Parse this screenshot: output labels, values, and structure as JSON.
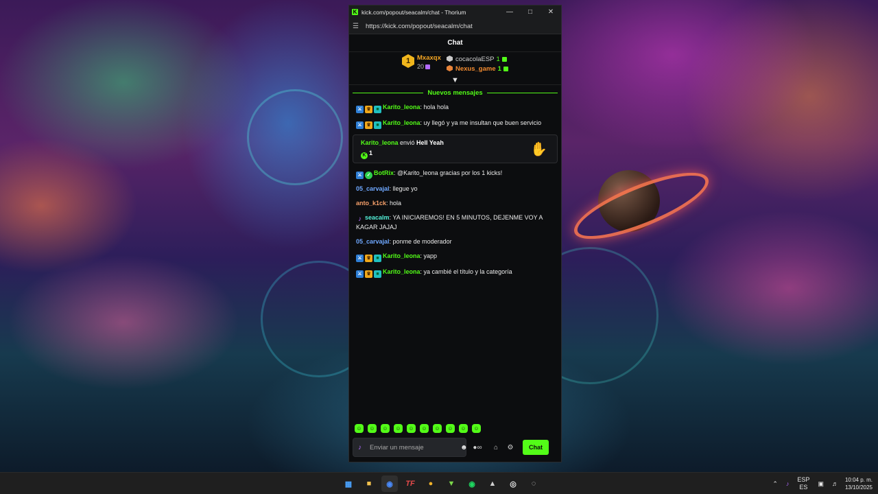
{
  "window": {
    "title": "kick.com/popout/seacalm/chat - Thorium",
    "url": "https://kick.com/popout/seacalm/chat",
    "logo_letter": "K"
  },
  "chat": {
    "header": "Chat",
    "leaderboard": {
      "top": {
        "rank": "1",
        "name": "Mxaxqx",
        "count": "20"
      },
      "others": [
        {
          "name": "cocacolaESP",
          "count": "1"
        },
        {
          "name": "Nexus_game",
          "count": "1"
        }
      ]
    },
    "new_messages_label": "Nuevos mensajes",
    "messages_before_gift": [
      {
        "name": "Karito_leona",
        "text": ": hola hola"
      },
      {
        "name": "Karito_leona",
        "text": ": uy llegó y ya me insultan que buen servicio"
      }
    ],
    "gift": {
      "sender": "Karito_leona",
      "verb": " envió ",
      "item": "Hell Yeah",
      "amount": "1"
    },
    "botrix": {
      "name": "BotRix",
      "text": ": @Karito_leona gracias por los 1 kicks!"
    },
    "plain_messages": [
      {
        "name": "05_carvajal",
        "text": ": llegue yo"
      },
      {
        "name": "anto_k1ck",
        "text": ": hola"
      }
    ],
    "streamer_msg": {
      "name": "seacalm",
      "text": ": YA INICIAREMOS! EN 5 MINUTOS, DEJENME VOY A KAGAR JAJAJ"
    },
    "carvajal2": {
      "name": "05_carvajal",
      "text": ": ponme de moderador"
    },
    "messages_after": [
      {
        "name": "Karito_leona",
        "text": ": yapp"
      },
      {
        "name": "Karito_leona",
        "text": ": ya cambié el título y la categoría"
      }
    ],
    "input_placeholder": "Enviar un mensaje",
    "send_label": "Chat"
  },
  "taskbar": {
    "language": "ESP",
    "language_sub": "ES",
    "time": "10:04 p. m.",
    "date": "13/10/2025"
  },
  "colors": {
    "kick_green": "#53fc18",
    "window_bg": "#0c0d0f"
  }
}
